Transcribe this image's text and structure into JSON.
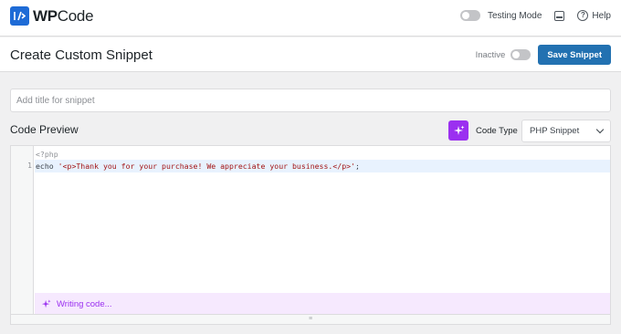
{
  "brand": {
    "name_bold": "WP",
    "name_thin": "Code",
    "logo_glyph": "/>",
    "accent": "#1e6bd6"
  },
  "topbar": {
    "testing_mode_label": "Testing Mode",
    "help_label": "Help",
    "help_glyph": "?"
  },
  "header": {
    "title": "Create Custom Snippet",
    "status_label": "Inactive",
    "save_label": "Save Snippet",
    "save_color": "#2271b1"
  },
  "title_field": {
    "placeholder": "Add title for snippet",
    "value": ""
  },
  "preview": {
    "title": "Code Preview",
    "ai_icon": "sparkle-icon",
    "ai_color": "#9b30f0",
    "code_type_label": "Code Type",
    "code_type_value": "PHP Snippet"
  },
  "editor": {
    "header_line": "<?php",
    "lines": [
      {
        "number": "1",
        "prefix": "echo ",
        "string": "'<p>Thank you for your purchase! We appreciate your business.</p>'",
        "suffix": ";"
      }
    ],
    "status_text": "Writing code...",
    "resize_glyph": "≡"
  }
}
